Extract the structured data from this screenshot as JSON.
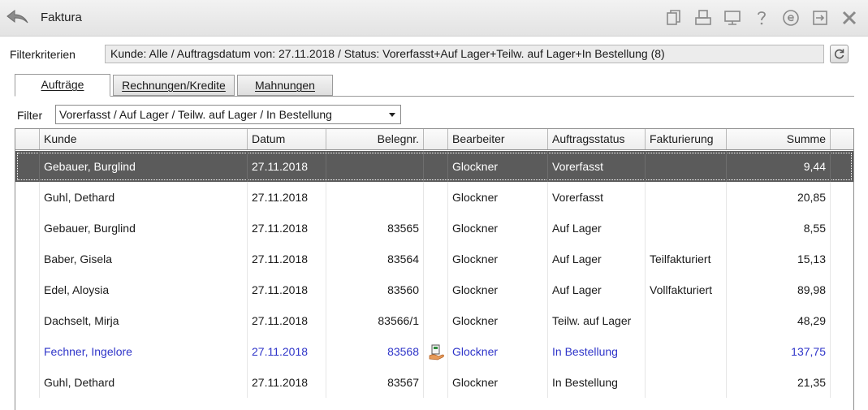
{
  "window": {
    "title": "Faktura"
  },
  "toolbar_icons": [
    "copy-icon",
    "print-icon",
    "monitor-icon",
    "help-icon",
    "e-icon",
    "export-icon",
    "close-icon"
  ],
  "filter_criteria": {
    "label": "Filterkriterien",
    "value": "Kunde: Alle / Auftragsdatum von: 27.11.2018 / Status: Vorerfasst+Auf Lager+Teilw. auf Lager+In Bestellung (8)"
  },
  "tabs": [
    {
      "label": "Aufträge",
      "active": true
    },
    {
      "label": "Rechnungen/Kredite",
      "active": false
    },
    {
      "label": "Mahnungen",
      "active": false
    }
  ],
  "filter": {
    "label": "Filter",
    "selected": "Vorerfasst / Auf Lager / Teilw. auf Lager / In Bestellung"
  },
  "table": {
    "headers": {
      "kunde": "Kunde",
      "datum": "Datum",
      "belegnr": "Belegnr.",
      "bearbeiter": "Bearbeiter",
      "status": "Auftragsstatus",
      "fakturierung": "Fakturierung",
      "summe": "Summe"
    },
    "rows": [
      {
        "kunde": "Gebauer, Burglind",
        "datum": "27.11.2018",
        "belegnr": "",
        "bearbeiter": "Glockner",
        "status": "Vorerfasst",
        "fakturierung": "",
        "summe": "9,44",
        "selected": true
      },
      {
        "kunde": "Guhl, Dethard",
        "datum": "27.11.2018",
        "belegnr": "",
        "bearbeiter": "Glockner",
        "status": "Vorerfasst",
        "fakturierung": "",
        "summe": "20,85"
      },
      {
        "kunde": "Gebauer, Burglind",
        "datum": "27.11.2018",
        "belegnr": "83565",
        "bearbeiter": "Glockner",
        "status": "Auf Lager",
        "fakturierung": "",
        "summe": "8,55"
      },
      {
        "kunde": "Baber, Gisela",
        "datum": "27.11.2018",
        "belegnr": "83564",
        "bearbeiter": "Glockner",
        "status": "Auf Lager",
        "fakturierung": "Teilfakturiert",
        "summe": "15,13"
      },
      {
        "kunde": "Edel, Aloysia",
        "datum": "27.11.2018",
        "belegnr": "83560",
        "bearbeiter": "Glockner",
        "status": "Auf Lager",
        "fakturierung": "Vollfakturiert",
        "summe": "89,98"
      },
      {
        "kunde": "Dachselt, Mirja",
        "datum": "27.11.2018",
        "belegnr": "83566/1",
        "bearbeiter": "Glockner",
        "status": "Teilw. auf Lager",
        "fakturierung": "",
        "summe": "48,29"
      },
      {
        "kunde": "Fechner, Ingelore",
        "datum": "27.11.2018",
        "belegnr": "83568",
        "bearbeiter": "Glockner",
        "status": "In Bestellung",
        "fakturierung": "",
        "summe": "137,75",
        "highlight": "#2f35c9",
        "icon": "order-hand-icon"
      },
      {
        "kunde": "Guhl, Dethard",
        "datum": "27.11.2018",
        "belegnr": "83567",
        "bearbeiter": "Glockner",
        "status": "In Bestellung",
        "fakturierung": "",
        "summe": "21,35"
      }
    ]
  }
}
